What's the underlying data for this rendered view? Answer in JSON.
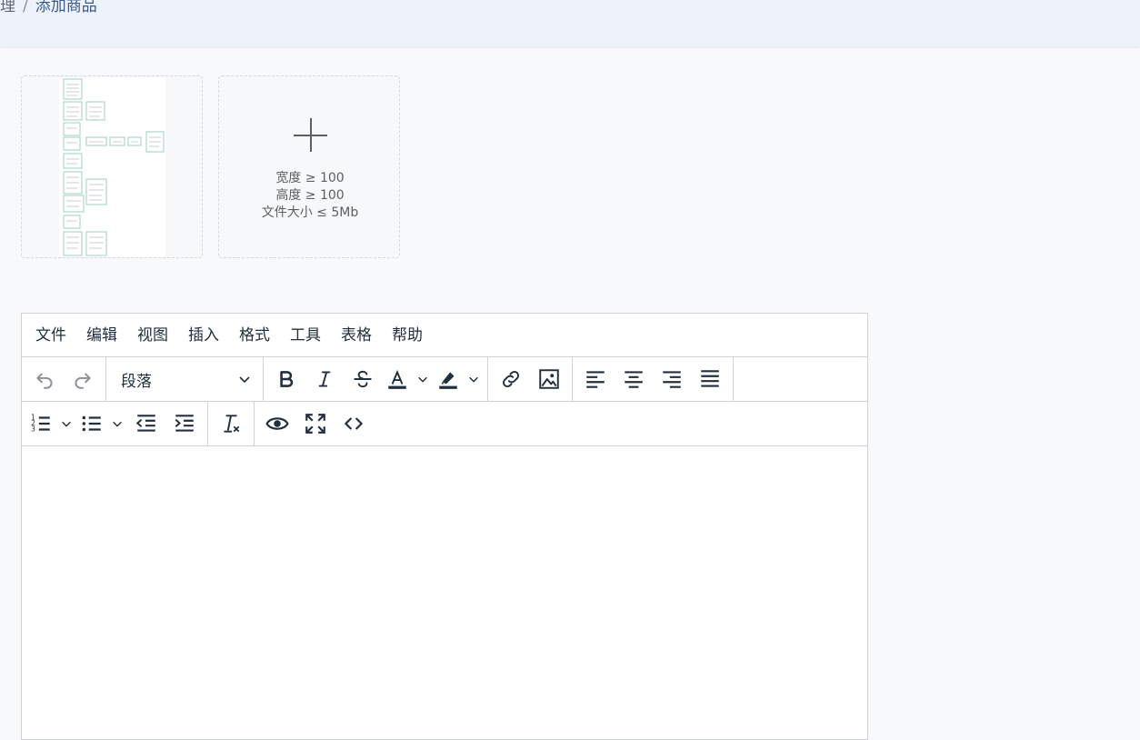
{
  "breadcrumb": {
    "previous": "理",
    "separator": "/",
    "current": "添加商品"
  },
  "upload": {
    "hint_width": "宽度 ≥ 100",
    "hint_height": "高度 ≥ 100",
    "hint_size": "文件大小 ≤ 5Mb",
    "add_icon": "plus-icon"
  },
  "editor": {
    "menu": [
      "文件",
      "编辑",
      "视图",
      "插入",
      "格式",
      "工具",
      "表格",
      "帮助"
    ],
    "block_format": "段落",
    "content": ""
  },
  "colors": {
    "accent": "#3a5b8c",
    "header_bg": "#eef2fa",
    "icon": "#222f3e",
    "icon_disabled": "#8a9099",
    "border": "#cfd3d8"
  }
}
